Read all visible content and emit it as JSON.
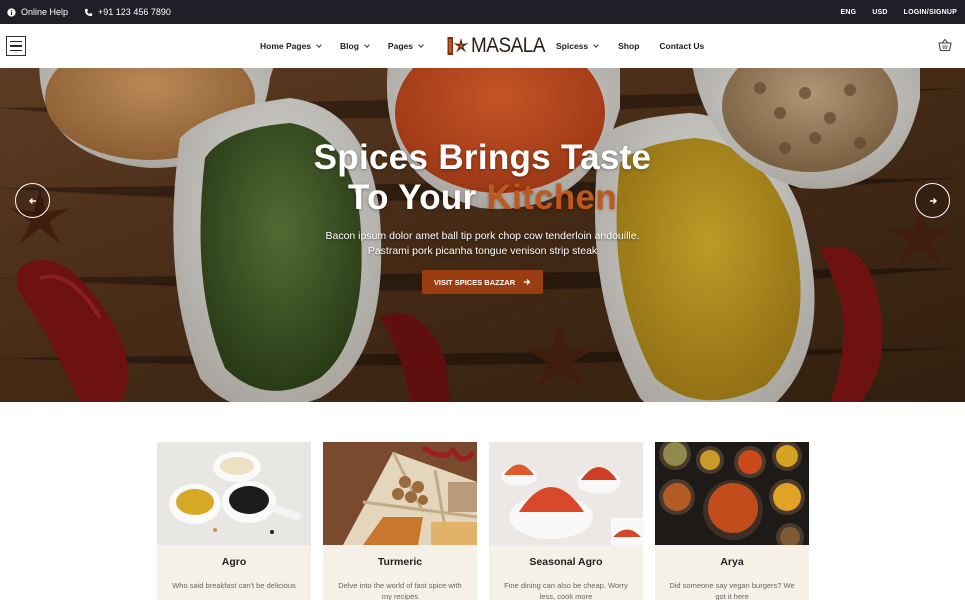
{
  "topbar": {
    "help_label": "Online Help",
    "phone": "+91 123 456 7890",
    "language": "ENG",
    "currency": "USD",
    "account": "LOGIN/SIGNUP"
  },
  "nav": {
    "items_left": [
      {
        "label": "Home Pages",
        "dropdown": true
      },
      {
        "label": "Blog",
        "dropdown": true
      },
      {
        "label": "Pages",
        "dropdown": true
      }
    ],
    "logo_text": "MASALA",
    "items_right": [
      {
        "label": "Spicess",
        "dropdown": true
      },
      {
        "label": "Shop",
        "dropdown": false
      },
      {
        "label": "Contact Us",
        "dropdown": false
      }
    ]
  },
  "hero": {
    "title_line1": "Spices Brings Taste",
    "title_line2_plain": "To Your ",
    "title_line2_accent": "Kitchen",
    "subtitle_line1": "Bacon ipsum dolor amet ball tip pork chop cow tenderloin andouille.",
    "subtitle_line2": "Pastrami pork picanha tongue venison strip steak",
    "button_label": "VISIT SPICES BAZZAR",
    "accent_color": "#c2571b",
    "button_color": "#9a3d11"
  },
  "cards": [
    {
      "title": "Agro",
      "desc": "Who said breakfast can't be delicious"
    },
    {
      "title": "Turmeric",
      "desc": "Delve into the world of fast spice with my recipes"
    },
    {
      "title": "Seasonal Agro",
      "desc": "Fine dining can also be cheap. Worry less, cook more"
    },
    {
      "title": "Arya",
      "desc": "Did someone say vegan burgers? We got it here"
    }
  ]
}
